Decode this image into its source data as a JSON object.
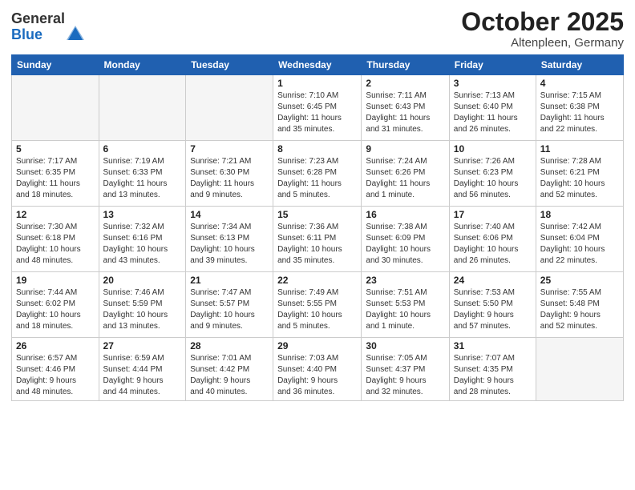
{
  "header": {
    "logo_general": "General",
    "logo_blue": "Blue",
    "month_title": "October 2025",
    "subtitle": "Altenpleen, Germany"
  },
  "days_of_week": [
    "Sunday",
    "Monday",
    "Tuesday",
    "Wednesday",
    "Thursday",
    "Friday",
    "Saturday"
  ],
  "weeks": [
    [
      {
        "day": "",
        "info": ""
      },
      {
        "day": "",
        "info": ""
      },
      {
        "day": "",
        "info": ""
      },
      {
        "day": "1",
        "info": "Sunrise: 7:10 AM\nSunset: 6:45 PM\nDaylight: 11 hours\nand 35 minutes."
      },
      {
        "day": "2",
        "info": "Sunrise: 7:11 AM\nSunset: 6:43 PM\nDaylight: 11 hours\nand 31 minutes."
      },
      {
        "day": "3",
        "info": "Sunrise: 7:13 AM\nSunset: 6:40 PM\nDaylight: 11 hours\nand 26 minutes."
      },
      {
        "day": "4",
        "info": "Sunrise: 7:15 AM\nSunset: 6:38 PM\nDaylight: 11 hours\nand 22 minutes."
      }
    ],
    [
      {
        "day": "5",
        "info": "Sunrise: 7:17 AM\nSunset: 6:35 PM\nDaylight: 11 hours\nand 18 minutes."
      },
      {
        "day": "6",
        "info": "Sunrise: 7:19 AM\nSunset: 6:33 PM\nDaylight: 11 hours\nand 13 minutes."
      },
      {
        "day": "7",
        "info": "Sunrise: 7:21 AM\nSunset: 6:30 PM\nDaylight: 11 hours\nand 9 minutes."
      },
      {
        "day": "8",
        "info": "Sunrise: 7:23 AM\nSunset: 6:28 PM\nDaylight: 11 hours\nand 5 minutes."
      },
      {
        "day": "9",
        "info": "Sunrise: 7:24 AM\nSunset: 6:26 PM\nDaylight: 11 hours\nand 1 minute."
      },
      {
        "day": "10",
        "info": "Sunrise: 7:26 AM\nSunset: 6:23 PM\nDaylight: 10 hours\nand 56 minutes."
      },
      {
        "day": "11",
        "info": "Sunrise: 7:28 AM\nSunset: 6:21 PM\nDaylight: 10 hours\nand 52 minutes."
      }
    ],
    [
      {
        "day": "12",
        "info": "Sunrise: 7:30 AM\nSunset: 6:18 PM\nDaylight: 10 hours\nand 48 minutes."
      },
      {
        "day": "13",
        "info": "Sunrise: 7:32 AM\nSunset: 6:16 PM\nDaylight: 10 hours\nand 43 minutes."
      },
      {
        "day": "14",
        "info": "Sunrise: 7:34 AM\nSunset: 6:13 PM\nDaylight: 10 hours\nand 39 minutes."
      },
      {
        "day": "15",
        "info": "Sunrise: 7:36 AM\nSunset: 6:11 PM\nDaylight: 10 hours\nand 35 minutes."
      },
      {
        "day": "16",
        "info": "Sunrise: 7:38 AM\nSunset: 6:09 PM\nDaylight: 10 hours\nand 30 minutes."
      },
      {
        "day": "17",
        "info": "Sunrise: 7:40 AM\nSunset: 6:06 PM\nDaylight: 10 hours\nand 26 minutes."
      },
      {
        "day": "18",
        "info": "Sunrise: 7:42 AM\nSunset: 6:04 PM\nDaylight: 10 hours\nand 22 minutes."
      }
    ],
    [
      {
        "day": "19",
        "info": "Sunrise: 7:44 AM\nSunset: 6:02 PM\nDaylight: 10 hours\nand 18 minutes."
      },
      {
        "day": "20",
        "info": "Sunrise: 7:46 AM\nSunset: 5:59 PM\nDaylight: 10 hours\nand 13 minutes."
      },
      {
        "day": "21",
        "info": "Sunrise: 7:47 AM\nSunset: 5:57 PM\nDaylight: 10 hours\nand 9 minutes."
      },
      {
        "day": "22",
        "info": "Sunrise: 7:49 AM\nSunset: 5:55 PM\nDaylight: 10 hours\nand 5 minutes."
      },
      {
        "day": "23",
        "info": "Sunrise: 7:51 AM\nSunset: 5:53 PM\nDaylight: 10 hours\nand 1 minute."
      },
      {
        "day": "24",
        "info": "Sunrise: 7:53 AM\nSunset: 5:50 PM\nDaylight: 9 hours\nand 57 minutes."
      },
      {
        "day": "25",
        "info": "Sunrise: 7:55 AM\nSunset: 5:48 PM\nDaylight: 9 hours\nand 52 minutes."
      }
    ],
    [
      {
        "day": "26",
        "info": "Sunrise: 6:57 AM\nSunset: 4:46 PM\nDaylight: 9 hours\nand 48 minutes."
      },
      {
        "day": "27",
        "info": "Sunrise: 6:59 AM\nSunset: 4:44 PM\nDaylight: 9 hours\nand 44 minutes."
      },
      {
        "day": "28",
        "info": "Sunrise: 7:01 AM\nSunset: 4:42 PM\nDaylight: 9 hours\nand 40 minutes."
      },
      {
        "day": "29",
        "info": "Sunrise: 7:03 AM\nSunset: 4:40 PM\nDaylight: 9 hours\nand 36 minutes."
      },
      {
        "day": "30",
        "info": "Sunrise: 7:05 AM\nSunset: 4:37 PM\nDaylight: 9 hours\nand 32 minutes."
      },
      {
        "day": "31",
        "info": "Sunrise: 7:07 AM\nSunset: 4:35 PM\nDaylight: 9 hours\nand 28 minutes."
      },
      {
        "day": "",
        "info": ""
      }
    ]
  ]
}
